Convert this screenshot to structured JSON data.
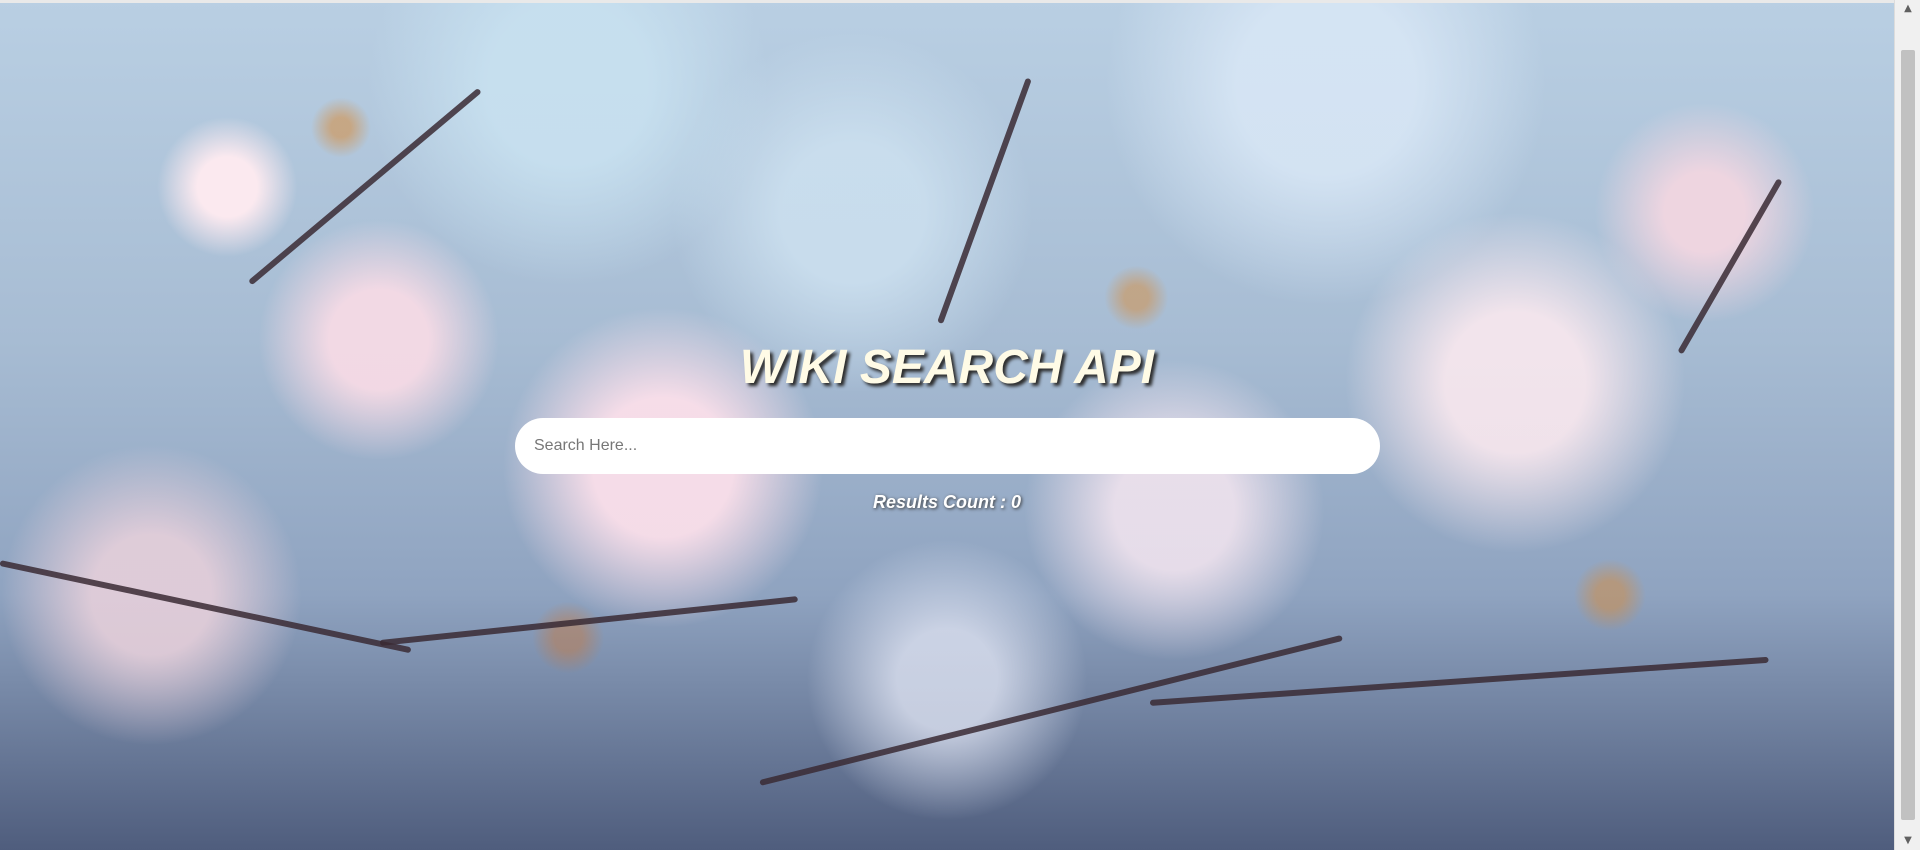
{
  "page": {
    "title": "WIKI SEARCH API"
  },
  "search": {
    "placeholder": "Search Here...",
    "value": ""
  },
  "results": {
    "label": "Results Count : 0"
  },
  "scrollbar": {
    "up_icon": "▲",
    "down_icon": "▼"
  },
  "colors": {
    "title": "#fffbe6",
    "input_bg": "#ffffff",
    "results_text": "#ffffff"
  }
}
